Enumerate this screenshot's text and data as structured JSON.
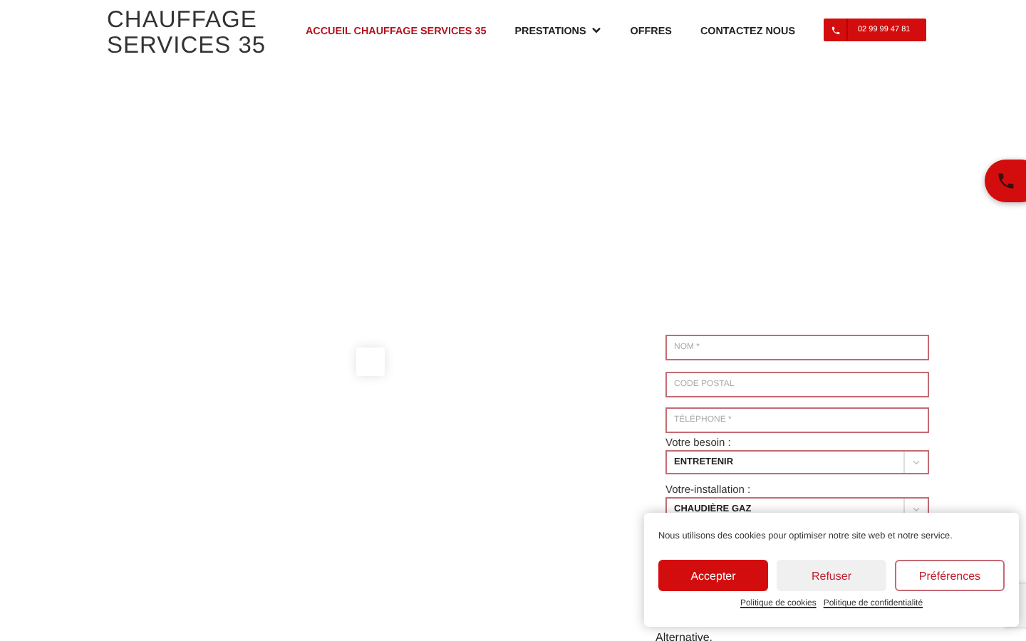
{
  "logo": {
    "lines": [
      "CHAUFFAGE",
      "SERVICES 35"
    ]
  },
  "nav": [
    {
      "label": "ACCUEIL CHAUFFAGE SERVICES 35",
      "selected": true,
      "dropdown": false
    },
    {
      "label": "PRESTATIONS",
      "selected": false,
      "dropdown": true
    },
    {
      "label": "OFFRES",
      "selected": false,
      "dropdown": false
    },
    {
      "label": "CONTACTEZ NOUS",
      "selected": false,
      "dropdown": false
    }
  ],
  "phone_button": {
    "label": "02 99 99 47 81"
  },
  "form": {
    "fields": [
      {
        "placeholder": "NOM *"
      },
      {
        "placeholder": "CODE POSTAL"
      },
      {
        "placeholder": "TÉLÉPHONE *"
      }
    ],
    "selects": [
      {
        "label": "Votre besoin :",
        "value": "ENTRETENIR"
      },
      {
        "label": "Votre-installation :",
        "value": "CHAUDIÈRE GAZ"
      }
    ],
    "note": "Alternative."
  },
  "cookie_banner": {
    "message": "Nous utilisons des cookies pour optimiser notre site web et notre service.",
    "buttons": [
      {
        "label": "Accepter",
        "kind": "primary"
      },
      {
        "label": "Refuser",
        "kind": "secondary"
      },
      {
        "label": "Préférences",
        "kind": "outline"
      }
    ],
    "links": [
      "Politique de cookies",
      "Politique de confidentialité"
    ]
  }
}
